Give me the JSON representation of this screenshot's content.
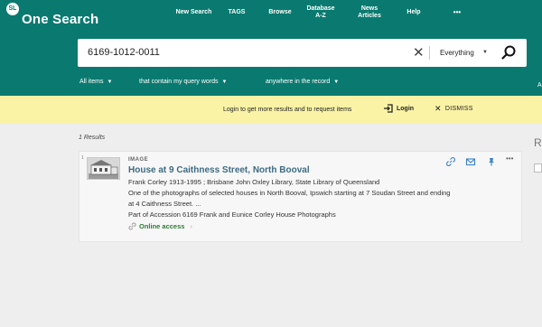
{
  "brand": {
    "badge": "SL",
    "name": "One Search"
  },
  "nav": {
    "new_search": "New Search",
    "tags": "TAGS",
    "browse": "Browse",
    "database_1": "Database",
    "database_2": "A-Z",
    "news_1": "News",
    "news_2": "Articles",
    "help": "Help",
    "more": "•••"
  },
  "search": {
    "query": "6169-1012-0011",
    "clear": "✕",
    "scope": "Everything"
  },
  "filters": {
    "type": "All items",
    "match": "that contain my query words",
    "field": "anywhere in the record",
    "right_cut": "A"
  },
  "banner": {
    "text": "Login to get more results and to request items",
    "login": "Login",
    "dismiss": "DISMISS"
  },
  "results": {
    "count": "1 Results",
    "right_heading": "R",
    "items": [
      {
        "number": "1",
        "type": "IMAGE",
        "title": "House at 9 Caithness Street, North Booval",
        "creator": "Frank Corley 1913-1995 ; Brisbane John Oxley Library, State Library of Queensland",
        "description_1": "One of the photographs of selected houses in North Booval, Ipswich starting at 7 Soudan Street and ending",
        "description_2": "at 4 Caithness Street. ...",
        "collection": "Part of Accession 6169 Frank and Eunice Corley House Photographs",
        "access": "Online access",
        "more_actions": "•••"
      }
    ]
  },
  "colors": {
    "header": "#0a7a70",
    "banner": "#faf3a6",
    "title": "#3d6b84",
    "online": "#2e7d32",
    "icon_blue": "#3b82c4"
  }
}
